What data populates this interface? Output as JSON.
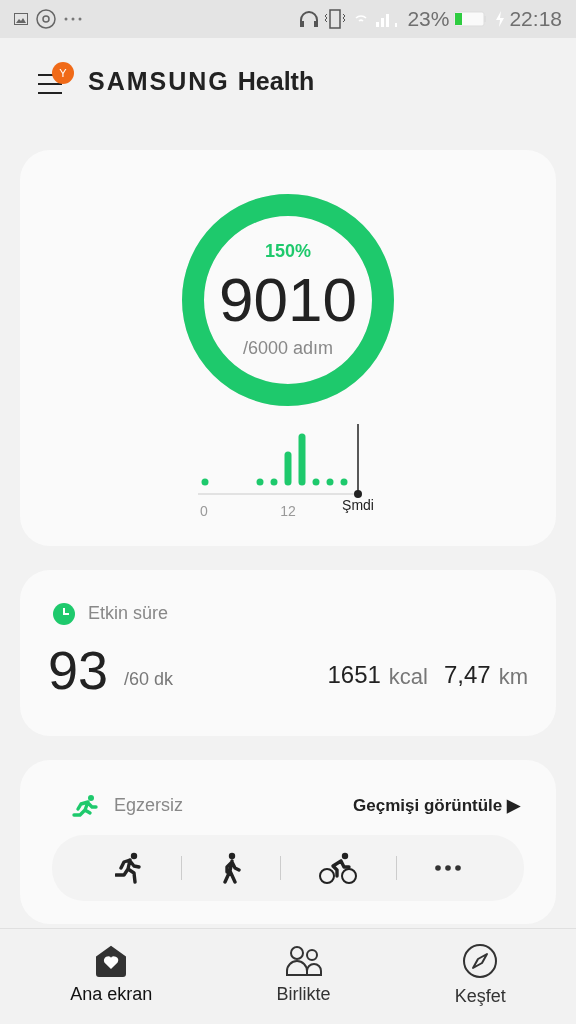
{
  "status_bar": {
    "battery_percent": "23%",
    "time": "22:18"
  },
  "header": {
    "brand": "SAMSUNG",
    "product": "Health",
    "menu_badge": "Y"
  },
  "steps": {
    "percent": "150%",
    "count": "9010",
    "goal": "/6000 adım",
    "level": 1,
    "axis_labels": [
      "0",
      "12",
      "Şmdi"
    ]
  },
  "active_time": {
    "title": "Etkin süre",
    "minutes": "93",
    "goal": "/60 dk",
    "calories": "1651",
    "calories_unit": "kcal",
    "distance": "7,47",
    "distance_unit": "km"
  },
  "exercise": {
    "title": "Egzersiz",
    "history_link": "Geçmişi görüntüle",
    "history_arrow": "▶",
    "shortcuts": [
      {
        "kind": "run"
      },
      {
        "kind": "walk"
      },
      {
        "kind": "bike"
      },
      {
        "kind": "more"
      }
    ]
  },
  "bottom_nav": [
    {
      "label": "Ana ekran",
      "kind": "home",
      "selected": true
    },
    {
      "label": "Birlikte",
      "kind": "together",
      "selected": false
    },
    {
      "label": "Keşfet",
      "kind": "discover",
      "selected": false
    }
  ]
}
